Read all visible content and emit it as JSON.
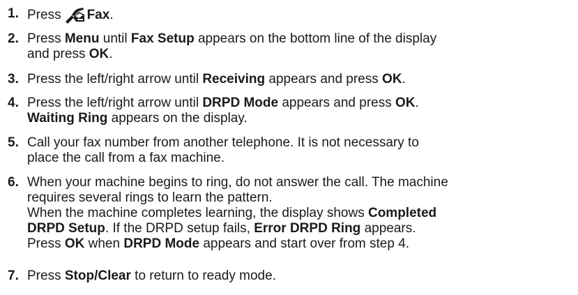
{
  "steps": [
    {
      "number": "1.",
      "press": "Press",
      "icon": "fax-phone-icon",
      "label": "Fax",
      "end": "."
    },
    {
      "number": "2.",
      "l1a": "Press ",
      "menu": "Menu",
      "l1b": " until ",
      "fax_setup": "Fax Setup",
      "l1c": " appears on the bottom line of the display",
      "l2a": "and press ",
      "ok": "OK",
      "l2b": "."
    },
    {
      "number": "3.",
      "a": "Press the left/right arrow until ",
      "receiving": "Receiving",
      "b": " appears and press ",
      "ok": "OK",
      "c": "."
    },
    {
      "number": "4.",
      "a": "Press the left/right arrow until ",
      "drpd_mode": "DRPD Mode",
      "b": " appears and press ",
      "ok": "OK",
      "c": ".",
      "waiting_ring": "Waiting Ring",
      "d": " appears on the display."
    },
    {
      "number": "5.",
      "line1": "Call your fax number from another telephone. It is not necessary to",
      "line2": "place the call from a fax machine."
    },
    {
      "number": "6.",
      "line1": "When your machine begins to ring, do not answer the call. The machine",
      "line2": "requires several rings to learn the pattern.",
      "p2a": "When the machine completes learning, the display shows ",
      "completed": "Completed",
      "drpd_setup": "DRPD Setup",
      "p2b": ". If the DRPD setup fails, ",
      "error_ring": "Error DRPD Ring",
      "p2c": " appears.",
      "p3a": "Press ",
      "ok": "OK",
      "p3b": " when ",
      "drpd_mode": "DRPD Mode",
      "p3c": " appears and start over from step 4."
    },
    {
      "number": "7.",
      "a": "Press ",
      "stop_clear": "Stop/Clear",
      "b": " to return to ready mode."
    }
  ]
}
